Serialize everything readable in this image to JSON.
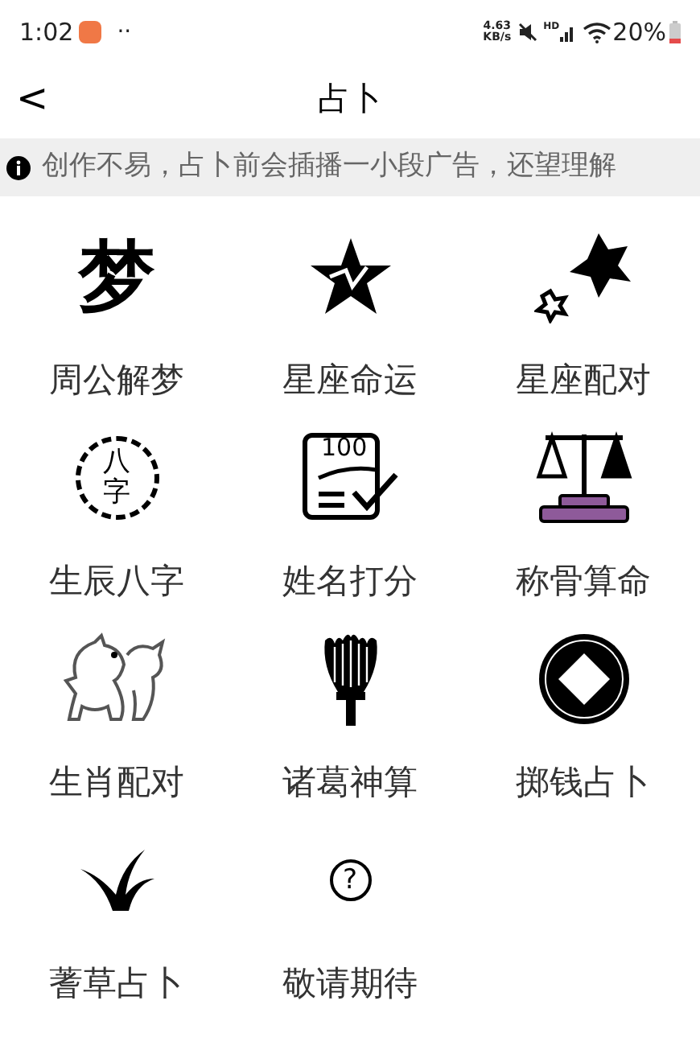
{
  "status_bar": {
    "time": "1:02",
    "dots": "··",
    "speed": "4.63",
    "speed_unit": "KB/s",
    "network": "HD",
    "battery": "20%"
  },
  "header": {
    "back": "<",
    "title": "占卜"
  },
  "notice": {
    "text": "创作不易，占卜前会插播一小段广告，还望理解"
  },
  "items": [
    {
      "label": "周公解梦",
      "kind": "dream",
      "glyph": "梦"
    },
    {
      "label": "星座命运",
      "kind": "star-chart"
    },
    {
      "label": "星座配对",
      "kind": "stars"
    },
    {
      "label": "生辰八字",
      "kind": "seal",
      "glyph": "八字"
    },
    {
      "label": "姓名打分",
      "kind": "score",
      "glyph": "100"
    },
    {
      "label": "称骨算命",
      "kind": "scale"
    },
    {
      "label": "生肖配对",
      "kind": "animals"
    },
    {
      "label": "诸葛神算",
      "kind": "fan"
    },
    {
      "label": "掷钱占卜",
      "kind": "coin"
    },
    {
      "label": "蓍草占卜",
      "kind": "grass"
    },
    {
      "label": "敬请期待",
      "kind": "question",
      "glyph": "?"
    }
  ]
}
